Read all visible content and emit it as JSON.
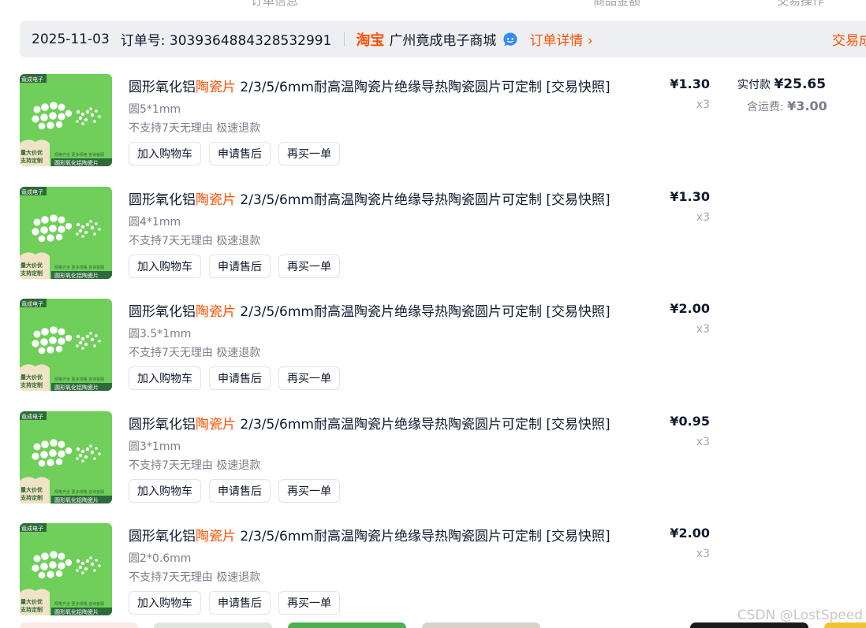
{
  "top_cutoff": [
    "订单信息",
    "商品金额",
    "交易操作"
  ],
  "order": {
    "date": "2025-11-03",
    "order_no": "订单号: 3039364884328532991",
    "platform": "淘宝",
    "shop": "广州竟成电子商城",
    "detail_link": "订单详情 ›",
    "trade_status": "交易成功"
  },
  "payment": {
    "paid_label": "实付款",
    "paid_amount": "¥25.65",
    "freight_label": "含运费:",
    "freight_amount": "¥3.00"
  },
  "items": [
    {
      "title_pre": "圆形氧化铝",
      "title_hl": "陶瓷片",
      "title_post": " 2/3/5/6mm耐高温陶瓷片绝缘导热陶瓷圆片可定制 [交易快照]",
      "spec": "圆5*1mm",
      "service": "不支持7天无理由 极速退款",
      "price": "¥1.30",
      "qty": "x3",
      "actions": [
        "加入购物车",
        "申请售后",
        "再买一单"
      ]
    },
    {
      "title_pre": "圆形氧化铝",
      "title_hl": "陶瓷片",
      "title_post": " 2/3/5/6mm耐高温陶瓷片绝缘导热陶瓷圆片可定制 [交易快照]",
      "spec": "圆4*1mm",
      "service": "不支持7天无理由 极速退款",
      "price": "¥1.30",
      "qty": "x3",
      "actions": [
        "加入购物车",
        "申请售后",
        "再买一单"
      ]
    },
    {
      "title_pre": "圆形氧化铝",
      "title_hl": "陶瓷片",
      "title_post": " 2/3/5/6mm耐高温陶瓷片绝缘导热陶瓷圆片可定制 [交易快照]",
      "spec": "圆3.5*1mm",
      "service": "不支持7天无理由 极速退款",
      "price": "¥2.00",
      "qty": "x3",
      "actions": [
        "加入购物车",
        "申请售后",
        "再买一单"
      ]
    },
    {
      "title_pre": "圆形氧化铝",
      "title_hl": "陶瓷片",
      "title_post": " 2/3/5/6mm耐高温陶瓷片绝缘导热陶瓷圆片可定制 [交易快照]",
      "spec": "圆3*1mm",
      "service": "不支持7天无理由 极速退款",
      "price": "¥0.95",
      "qty": "x3",
      "actions": [
        "加入购物车",
        "申请售后",
        "再买一单"
      ]
    },
    {
      "title_pre": "圆形氧化铝",
      "title_hl": "陶瓷片",
      "title_post": " 2/3/5/6mm耐高温陶瓷片绝缘导热陶瓷圆片可定制 [交易快照]",
      "spec": "圆2*0.6mm",
      "service": "不支持7天无理由 极速退款",
      "price": "¥2.00",
      "qty": "x3",
      "actions": [
        "加入购物车",
        "申请售后",
        "再买一单"
      ]
    }
  ],
  "thumbnail": {
    "brand_tag": "竟成电子",
    "promo_1": "量大价优",
    "promo_2": "支持定制",
    "slogan": "规格齐全 更多规格 咨询客服",
    "caption": "圆形氧化铝陶瓷片",
    "bg_color": "#6fcf5a"
  },
  "icons": {
    "wangwang": "wangwang-chat-icon"
  },
  "colors": {
    "accent": "#ff5000",
    "header_bg": "#eeeff2"
  },
  "watermark": "CSDN @LostSpeed"
}
